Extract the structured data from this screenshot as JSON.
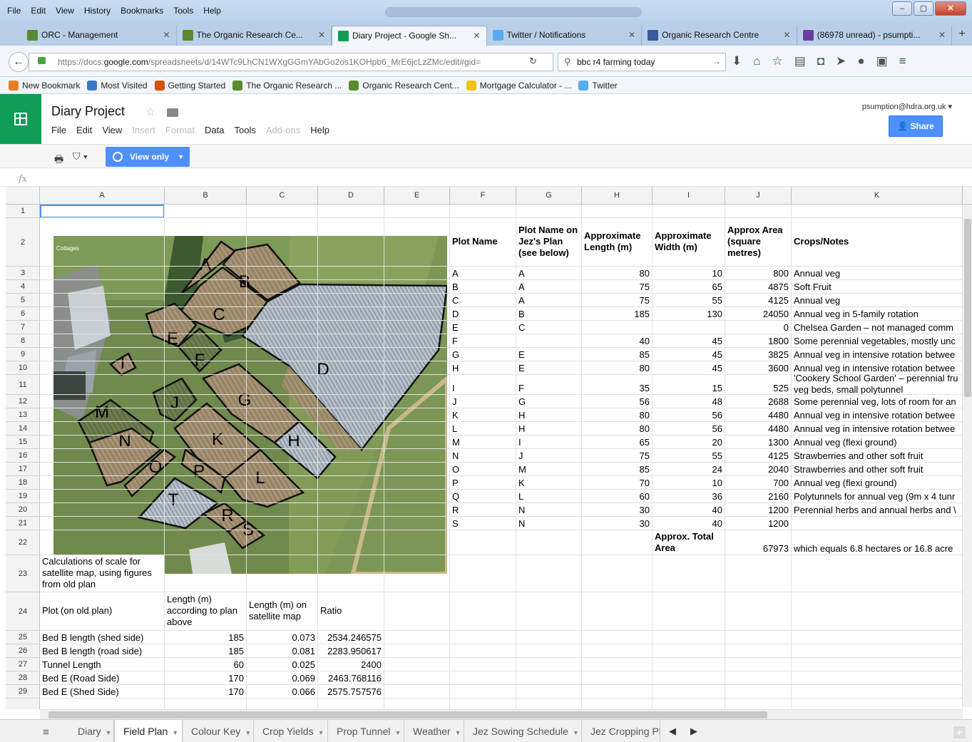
{
  "browser": {
    "menu": [
      "File",
      "Edit",
      "View",
      "History",
      "Bookmarks",
      "Tools",
      "Help"
    ],
    "tabs": [
      {
        "label": "ORC - Management",
        "icon": "leaf-icon"
      },
      {
        "label": "The Organic Research Ce...",
        "icon": "leaf-icon"
      },
      {
        "label": "Diary Project - Google Sh...",
        "icon": "sheets-icon"
      },
      {
        "label": "Twitter / Notifications",
        "icon": "twitter-icon"
      },
      {
        "label": "Organic Research Centre",
        "icon": "facebook-icon"
      },
      {
        "label": "(86978 unread) - psumpti...",
        "icon": "mail-icon"
      }
    ],
    "url_prefix": "https://docs.",
    "url_domain": "google.com",
    "url_rest": "/spreadsheets/d/14WTc9LhCN1WXgGGmYAbGo2os1KOHpb6_MrE6jcLzZMc/edit#gid=",
    "search_value": "bbc r4 farming today",
    "bookmarks": [
      "New Bookmark",
      "Most Visited",
      "Getting Started",
      "The Organic Research ...",
      "Organic Research Cent...",
      "Mortgage Calculator - ...",
      "Twitter"
    ]
  },
  "app": {
    "title": "Diary Project",
    "menu": [
      {
        "label": "File",
        "enabled": true
      },
      {
        "label": "Edit",
        "enabled": true
      },
      {
        "label": "View",
        "enabled": true
      },
      {
        "label": "Insert",
        "enabled": false
      },
      {
        "label": "Format",
        "enabled": false
      },
      {
        "label": "Data",
        "enabled": true
      },
      {
        "label": "Tools",
        "enabled": true
      },
      {
        "label": "Add-ons",
        "enabled": false
      },
      {
        "label": "Help",
        "enabled": true
      }
    ],
    "account": "psumption@hdra.org.uk",
    "share_label": "Share",
    "view_only_label": "View only",
    "fx_label": "fx"
  },
  "grid": {
    "columns": [
      "A",
      "B",
      "C",
      "D",
      "E",
      "F",
      "G",
      "H",
      "I",
      "J",
      "K"
    ],
    "rows": [
      "1",
      "2",
      "3",
      "4",
      "5",
      "6",
      "7",
      "8",
      "9",
      "10",
      "11",
      "12",
      "13",
      "14",
      "15",
      "16",
      "17",
      "18",
      "19",
      "20",
      "21",
      "22",
      "23",
      "24",
      "25",
      "26",
      "27",
      "28",
      "29"
    ],
    "plot_headers": [
      "Plot Name",
      "Plot Name on Jez's Plan (see below)",
      "Approximate Length (m)",
      "Approximate Width (m)",
      "Approx Area (square metres)",
      "Crops/Notes"
    ],
    "plots": [
      [
        "A",
        "A",
        "80",
        "10",
        "800",
        "Annual veg"
      ],
      [
        "B",
        "A",
        "75",
        "65",
        "4875",
        "Soft Fruit"
      ],
      [
        "C",
        "A",
        "75",
        "55",
        "4125",
        "Annual veg"
      ],
      [
        "D",
        "B",
        "185",
        "130",
        "24050",
        "Annual veg in 5-family rotation"
      ],
      [
        "E",
        "C",
        "",
        "",
        "0",
        "Chelsea Garden – not managed comm"
      ],
      [
        "F",
        "",
        "40",
        "45",
        "1800",
        "Some perennial vegetables, mostly unc"
      ],
      [
        "G",
        "E",
        "85",
        "45",
        "3825",
        "Annual veg in intensive rotation betwee"
      ],
      [
        "H",
        "E",
        "80",
        "45",
        "3600",
        "Annual veg in intensive rotation betwee"
      ],
      [
        "I",
        "F",
        "35",
        "15",
        "525",
        "'Cookery School Garden' – perennial fru veg beds, small polytunnel"
      ],
      [
        "J",
        "G",
        "56",
        "48",
        "2688",
        "Some perennial veg, lots of room for an"
      ],
      [
        "K",
        "H",
        "80",
        "56",
        "4480",
        "Annual veg in intensive rotation betwee"
      ],
      [
        "L",
        "H",
        "80",
        "56",
        "4480",
        "Annual veg in intensive rotation betwee"
      ],
      [
        "M",
        "I",
        "65",
        "20",
        "1300",
        "Annual veg (flexi ground)"
      ],
      [
        "N",
        "J",
        "75",
        "55",
        "4125",
        "Strawberries and other soft fruit"
      ],
      [
        "O",
        "M",
        "85",
        "24",
        "2040",
        "Strawberries and other soft fruit"
      ],
      [
        "P",
        "K",
        "70",
        "10",
        "700",
        "Annual veg (flexi ground)"
      ],
      [
        "Q",
        "L",
        "60",
        "36",
        "2160",
        "Polytunnels for annual veg (9m x 4 tunr"
      ],
      [
        "R",
        "N",
        "30",
        "40",
        "1200",
        "Perennial herbs and annual herbs and \\"
      ],
      [
        "S",
        "N",
        "30",
        "40",
        "1200",
        ""
      ]
    ],
    "total_label": "Approx. Total Area",
    "total_value": "67973",
    "total_note": "which equals 6.8 hectares or 16.8 acre",
    "scale_note": "Calculations of scale for satellite map, using figures from old plan",
    "scale_headers": [
      "Plot (on old plan)",
      "Length (m) according to plan above",
      "Length (m) on satellite map",
      "Ratio"
    ],
    "scale_rows": [
      [
        "Bed B length (shed side)",
        "185",
        "0.073",
        "2534.246575"
      ],
      [
        "Bed B length (road side)",
        "185",
        "0.081",
        "2283.950617"
      ],
      [
        "Tunnel Length",
        "60",
        "0.025",
        "2400"
      ],
      [
        "Bed E (Road Side)",
        "170",
        "0.069",
        "2463.768116"
      ],
      [
        "Bed E (Shed Side)",
        "170",
        "0.066",
        "2575.757576"
      ]
    ]
  },
  "map": {
    "labels": [
      "A",
      "B",
      "C",
      "D",
      "E",
      "F",
      "G",
      "H",
      "I",
      "J",
      "K",
      "L",
      "M",
      "N",
      "O",
      "P",
      "R",
      "S",
      "T"
    ],
    "corner_text": "Cottages"
  },
  "sheet_tabs": [
    {
      "label": "Diary",
      "active": false
    },
    {
      "label": "Field Plan",
      "active": true
    },
    {
      "label": "Colour Key",
      "active": false
    },
    {
      "label": "Crop Yields",
      "active": false
    },
    {
      "label": "Prop Tunnel",
      "active": false
    },
    {
      "label": "Weather",
      "active": false
    },
    {
      "label": "Jez Sowing Schedule",
      "active": false
    },
    {
      "label": "Jez Cropping Pl",
      "active": false
    }
  ]
}
